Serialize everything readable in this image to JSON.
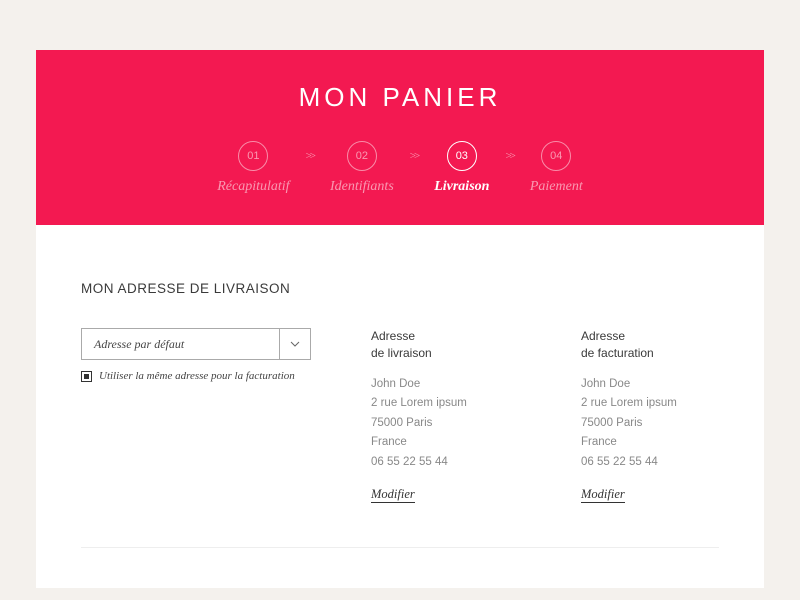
{
  "header": {
    "title": "MON PANIER",
    "steps": [
      {
        "num": "01",
        "label": "Récapitulatif",
        "active": false
      },
      {
        "num": "02",
        "label": "Identifiants",
        "active": false
      },
      {
        "num": "03",
        "label": "Livraison",
        "active": true
      },
      {
        "num": "04",
        "label": "Paiement",
        "active": false
      }
    ],
    "separator": ">>"
  },
  "content": {
    "section_title": "MON ADRESSE DE LIVRAISON",
    "select": {
      "value": "Adresse par défaut"
    },
    "checkbox": {
      "label": "Utiliser la même adresse pour la facturation",
      "checked": true
    },
    "shipping": {
      "title_line1": "Adresse",
      "title_line2": "de livraison",
      "name": "John Doe",
      "street": "2 rue Lorem ipsum",
      "city": "75000 Paris",
      "country": "France",
      "phone": "06 55 22 55 44",
      "modify": "Modifier"
    },
    "billing": {
      "title_line1": "Adresse",
      "title_line2": "de facturation",
      "name": "John Doe",
      "street": "2 rue Lorem ipsum",
      "city": "75000 Paris",
      "country": "France",
      "phone": "06 55 22 55 44",
      "modify": "Modifier"
    }
  }
}
